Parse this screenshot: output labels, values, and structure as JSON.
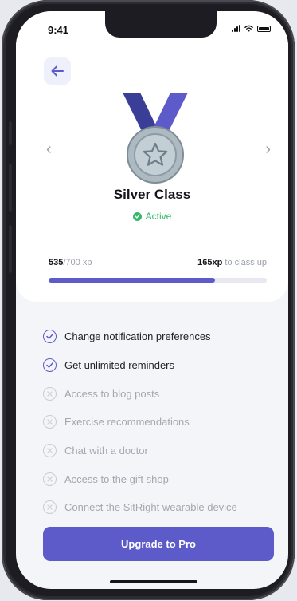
{
  "status_bar": {
    "time": "9:41"
  },
  "header": {
    "back_icon": "arrow-left-icon"
  },
  "carousel": {
    "prev_icon": "chevron-left-icon",
    "next_icon": "chevron-right-icon"
  },
  "class_card": {
    "medal_icon": "silver-medal-icon",
    "title": "Silver Class",
    "status": "Active",
    "status_color": "#33b86b"
  },
  "progress": {
    "current_xp": "535",
    "total_xp": "/700 xp",
    "remaining_xp": "165xp",
    "remaining_label": " to class up",
    "fraction": 0.764
  },
  "features": [
    {
      "label": "Change notification preferences",
      "enabled": true
    },
    {
      "label": "Get unlimited reminders",
      "enabled": true
    },
    {
      "label": "Access to blog posts",
      "enabled": false
    },
    {
      "label": "Exercise recommendations",
      "enabled": false
    },
    {
      "label": "Chat with a doctor",
      "enabled": false
    },
    {
      "label": "Access to the gift shop",
      "enabled": false
    },
    {
      "label": "Connect the SitRight wearable device",
      "enabled": false
    }
  ],
  "cta": {
    "label": "Upgrade to Pro"
  },
  "colors": {
    "accent": "#5d5bc9",
    "success": "#33b86b",
    "background": "#f4f5f9"
  }
}
